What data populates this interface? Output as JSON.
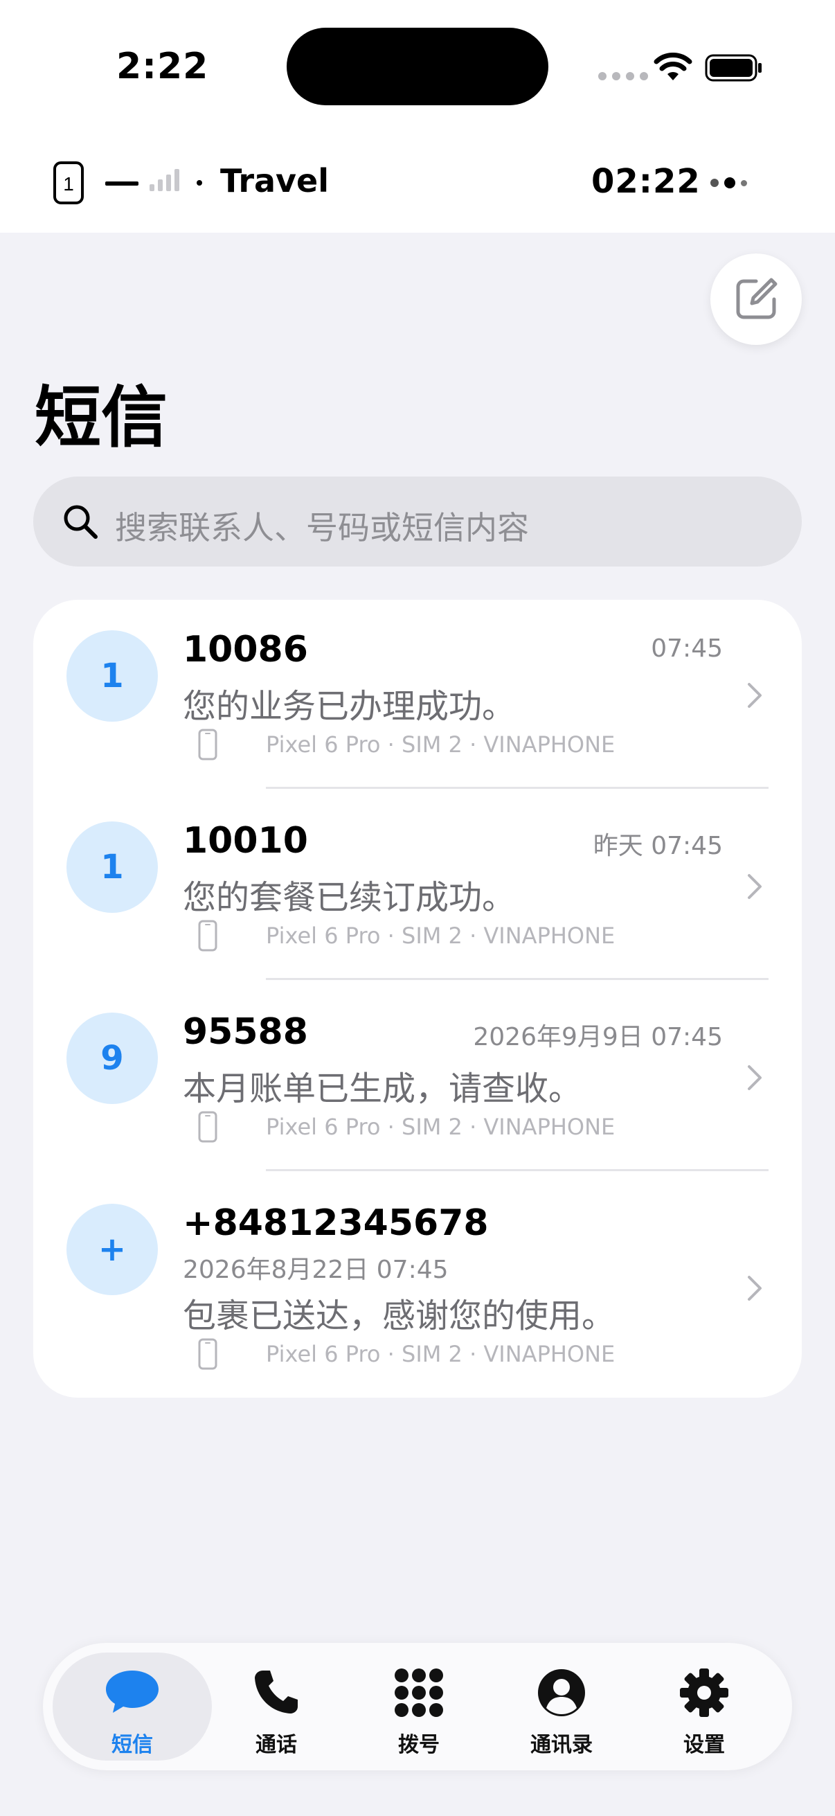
{
  "status_bar": {
    "time": "2:22"
  },
  "header": {
    "sim_slot": "1",
    "carrier": "Travel",
    "clock": "02:22"
  },
  "page": {
    "title": "短信"
  },
  "search": {
    "placeholder": "搜索联系人、号码或短信内容"
  },
  "messages": [
    {
      "avatar": "1",
      "name": "10086",
      "time": "07:45",
      "preview": "您的业务已办理成功。",
      "meta": "Pixel 6 Pro · SIM 2 · VINAPHONE"
    },
    {
      "avatar": "1",
      "name": "10010",
      "time": "昨天 07:45",
      "preview": "您的套餐已续订成功。",
      "meta": "Pixel 6 Pro · SIM 2 · VINAPHONE"
    },
    {
      "avatar": "9",
      "name": "95588",
      "time": "2026年9月9日 07:45",
      "preview": "本月账单已生成，请查收。",
      "meta": "Pixel 6 Pro · SIM 2 · VINAPHONE"
    },
    {
      "avatar": "+",
      "name": "+84812345678",
      "time": "2026年8月22日 07:45",
      "preview": "包裹已送达，感谢您的使用。",
      "meta": "Pixel 6 Pro · SIM 2 · VINAPHONE"
    }
  ],
  "tabs": [
    {
      "label": "短信",
      "icon": "message-bubble-icon",
      "active": true
    },
    {
      "label": "通话",
      "icon": "phone-icon",
      "active": false
    },
    {
      "label": "拨号",
      "icon": "keypad-icon",
      "active": false
    },
    {
      "label": "通讯录",
      "icon": "contact-icon",
      "active": false
    },
    {
      "label": "设置",
      "icon": "gear-icon",
      "active": false
    }
  ],
  "colors": {
    "accent": "#1d82ee",
    "avatar_bg": "#d9ecfd",
    "background": "#f2f2f7"
  }
}
